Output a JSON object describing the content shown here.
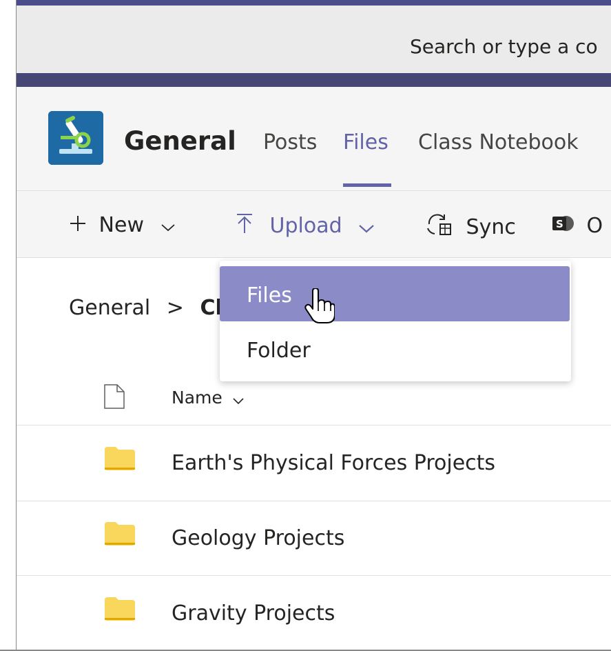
{
  "search": {
    "placeholder_visible": "Search or type a co"
  },
  "channel": {
    "name": "General",
    "tabs": [
      {
        "label": "Posts",
        "active": false
      },
      {
        "label": "Files",
        "active": true
      },
      {
        "label": "Class Notebook",
        "active": false
      }
    ]
  },
  "toolbar": {
    "new_label": "New",
    "upload_label": "Upload",
    "sync_label": "Sync",
    "open_label_partial": "O"
  },
  "breadcrumb": {
    "root": "General",
    "separator": ">",
    "current_partial": "Cl"
  },
  "upload_menu": {
    "items": [
      {
        "label": "Files",
        "highlighted": true
      },
      {
        "label": "Folder",
        "highlighted": false
      }
    ]
  },
  "file_list": {
    "column_name": "Name",
    "rows": [
      {
        "name": "Earth's Physical Forces Projects",
        "type": "folder"
      },
      {
        "name": "Geology Projects",
        "type": "folder"
      },
      {
        "name": "Gravity Projects",
        "type": "folder"
      }
    ]
  },
  "colors": {
    "accent": "#6264a7",
    "menu_highlight": "#8b8cc7",
    "top_bar": "#464775",
    "folder": "#f2c94c"
  },
  "icons": [
    "microscope-icon",
    "plus-icon",
    "chevron-down-icon",
    "upload-arrow-icon",
    "sync-icon",
    "sharepoint-icon",
    "hand-cursor-icon",
    "file-icon",
    "folder-icon"
  ]
}
